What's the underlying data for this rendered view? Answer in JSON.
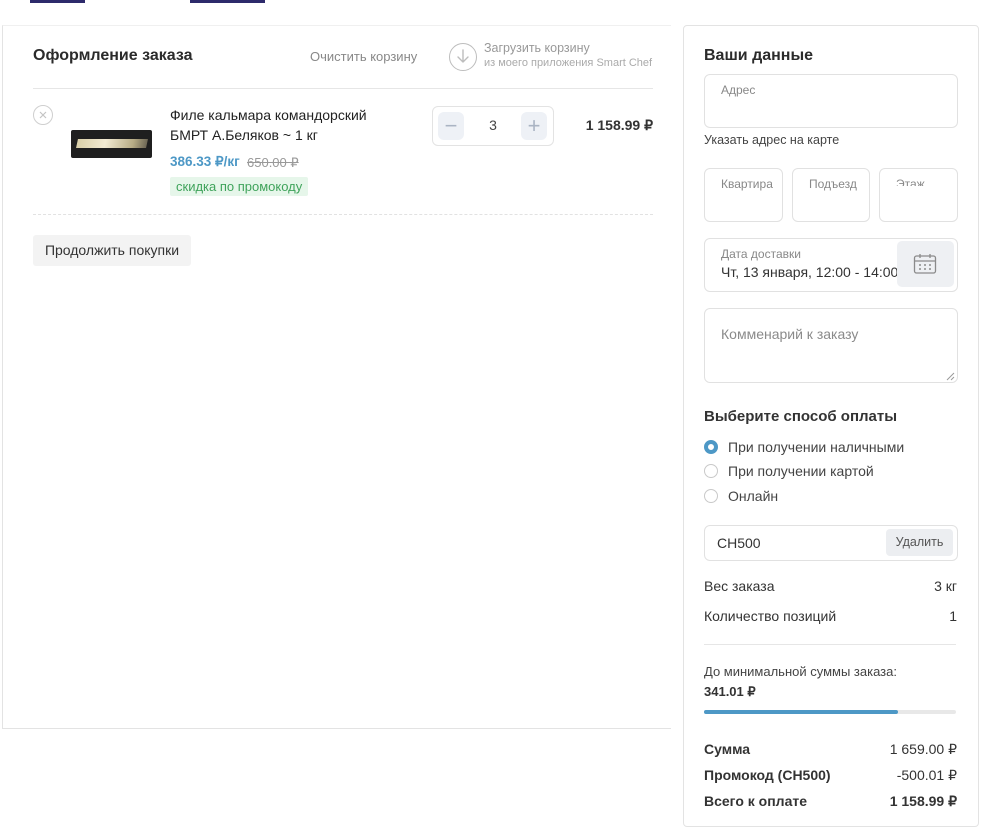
{
  "cart": {
    "title": "Оформление заказа",
    "clear_label": "Очистить корзину",
    "upload_title": "Загрузить корзину",
    "upload_subtitle": "из моего приложения Smart Chef",
    "continue_label": "Продолжить покупки",
    "items": [
      {
        "name": "Филе кальмара командорский БМРТ А.Беляков ~ 1 кг",
        "price_per": "386.33 ₽/кг",
        "price_old": "650.00 ₽",
        "badge": "скидка по промокоду",
        "quantity": "3",
        "minus_symbol": "−",
        "plus_symbol": "+",
        "total": "1 158.99 ₽"
      }
    ]
  },
  "customer": {
    "title": "Ваши данные",
    "address_placeholder": "Адрес",
    "map_link": "Указать адрес на карте",
    "apartment_placeholder": "Квартира",
    "entrance_placeholder": "Подъезд",
    "floor_placeholder": "Этаж",
    "delivery_label": "Дата доставки",
    "delivery_value": "Чт, 13 января, 12:00 - 14:00",
    "comment_placeholder": "Комменарий к заказу"
  },
  "payment": {
    "title": "Выберите способ оплаты",
    "options": [
      {
        "label": "При получении наличными",
        "selected": true
      },
      {
        "label": "При получении картой",
        "selected": false
      },
      {
        "label": "Онлайн",
        "selected": false
      }
    ]
  },
  "promo": {
    "code": "CH500",
    "remove_label": "Удалить"
  },
  "summary": {
    "weight_label": "Вес заказа",
    "weight_value": "3 кг",
    "positions_label": "Количество позиций",
    "positions_value": "1",
    "min_order_note": "До минимальной суммы заказа:",
    "min_order_value": "341.01 ₽",
    "min_order_progress": 0.77,
    "sum_label": "Сумма",
    "sum_value": "1 659.00 ₽",
    "promo_label": "Промокод (CH500)",
    "promo_value": "-500.01 ₽",
    "total_label": "Всего к оплате",
    "total_value": "1 158.99 ₽"
  },
  "colors": {
    "accent": "#4d98c6",
    "promo_green": "#3fa35b",
    "header_navy": "#2d2a6b"
  },
  "icons": {
    "upload": "download-circle-icon",
    "remove": "close-circle-icon",
    "calendar": "calendar-icon"
  }
}
